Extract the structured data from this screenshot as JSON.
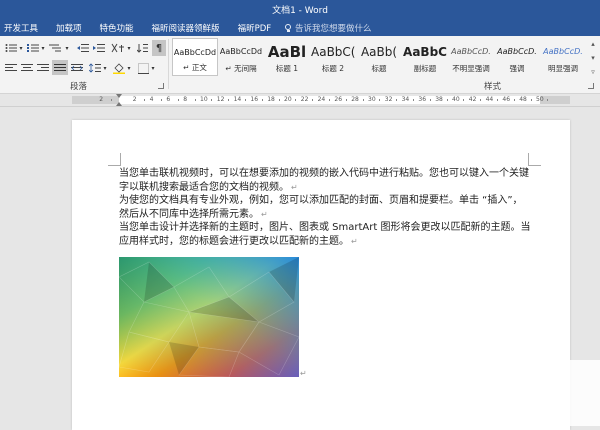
{
  "window": {
    "title": "文档1 - Word"
  },
  "tabs": [
    "开发工具",
    "加载项",
    "特色功能",
    "福昕阅读器领鲜版",
    "福昕PDF"
  ],
  "tell_me": {
    "placeholder": "告诉我您想要做什么"
  },
  "ribbon": {
    "paragraph_label": "段落",
    "styles_label": "样式",
    "styles": [
      {
        "preview": "AaBbCcDd",
        "name": "↵ 正文",
        "selected": true
      },
      {
        "preview": "AaBbCcDd",
        "name": "↵ 无间隔",
        "selected": false
      },
      {
        "preview": "AaBl",
        "name": "标题 1",
        "selected": false
      },
      {
        "preview": "AaBbC(",
        "name": "标题 2",
        "selected": false
      },
      {
        "preview": "AaBb(",
        "name": "标题",
        "selected": false
      },
      {
        "preview": "AaBbC",
        "name": "副标题",
        "selected": false
      },
      {
        "preview": "AaBbCcD.",
        "name": "不明显强调",
        "selected": false
      },
      {
        "preview": "AaBbCcD.",
        "name": "强调",
        "selected": false
      },
      {
        "preview": "AaBbCcD.",
        "name": "明显强调",
        "selected": false
      }
    ]
  },
  "ruler": {
    "numbers": [
      "2",
      "2",
      "4",
      "6",
      "8",
      "10",
      "12",
      "14",
      "16",
      "18",
      "20",
      "22",
      "24",
      "26",
      "28",
      "30",
      "32",
      "34",
      "36",
      "38",
      "40",
      "42",
      "44",
      "46",
      "48",
      "50"
    ]
  },
  "document": {
    "paragraphs": [
      "当您单击联机视频时，可以在想要添加的视频的嵌入代码中进行粘贴。您也可以键入一个关键字以联机搜索最适合您的文档的视频。",
      "为使您的文档具有专业外观，例如，您可以添加匹配的封面、页眉和提要栏。单击 “插入”，然后从不同库中选择所需元素。",
      "当您单击设计并选择新的主题时，图片、图表或 SmartArt 图形将会更改以匹配新的主题。当应用样式时，您的标题会进行更改以匹配新的主题。"
    ],
    "paragraph_mark": "↵"
  },
  "colors": {
    "accent": "#2b579a",
    "ribbon": "#f3f3f3",
    "workspace": "#e6e6e6"
  }
}
